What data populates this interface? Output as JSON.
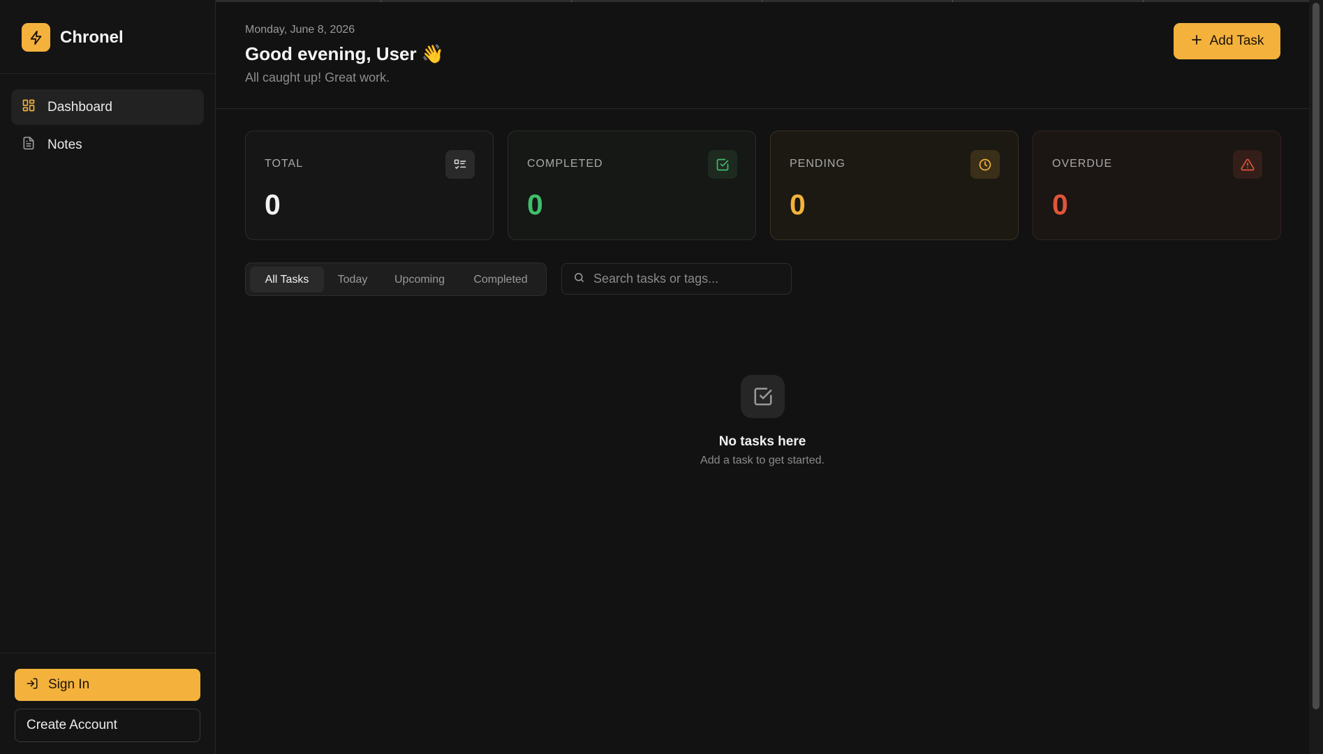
{
  "app": {
    "name": "Chronel",
    "logo_icon": "bolt-icon"
  },
  "sidebar": {
    "items": [
      {
        "label": "Dashboard",
        "icon": "dashboard-grid-icon",
        "active": true
      },
      {
        "label": "Notes",
        "icon": "document-icon",
        "active": false
      }
    ],
    "sign_in_label": "Sign In",
    "create_account_label": "Create Account"
  },
  "header": {
    "date": "Monday, June 8, 2026",
    "greeting": "Good evening, User 👋",
    "subtitle": "All caught up! Great work.",
    "add_task_label": "Add Task"
  },
  "stats": [
    {
      "label": "TOTAL",
      "value": "0",
      "icon": "list-check-icon",
      "color": "#f2f2f2"
    },
    {
      "label": "COMPLETED",
      "value": "0",
      "icon": "square-check-icon",
      "color": "#3fbf6a"
    },
    {
      "label": "PENDING",
      "value": "0",
      "icon": "clock-icon",
      "color": "#f4b23c"
    },
    {
      "label": "OVERDUE",
      "value": "0",
      "icon": "warning-triangle-icon",
      "color": "#e0553a"
    }
  ],
  "filters": {
    "tabs": [
      "All Tasks",
      "Today",
      "Upcoming",
      "Completed"
    ],
    "active": "All Tasks"
  },
  "search": {
    "placeholder": "Search tasks or tags...",
    "value": ""
  },
  "empty_state": {
    "title": "No tasks here",
    "subtitle": "Add a task to get started.",
    "icon": "square-check-icon"
  },
  "colors": {
    "accent": "#f4b23c",
    "background": "#121212",
    "success": "#3fbf6a",
    "danger": "#e0553a"
  }
}
